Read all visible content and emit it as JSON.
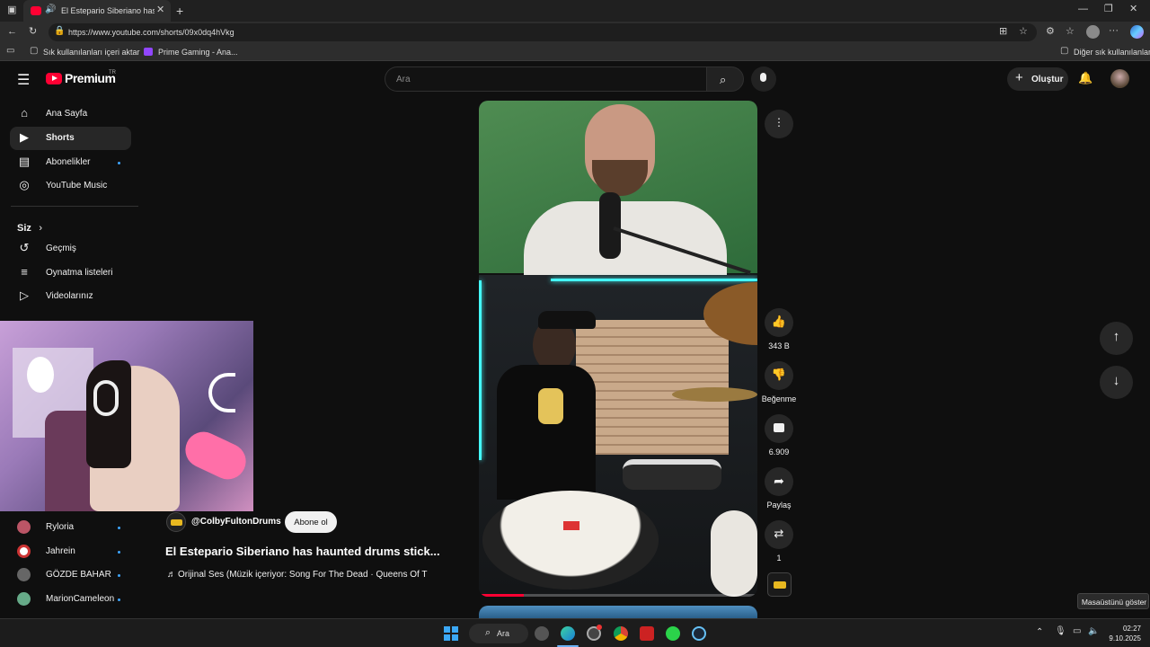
{
  "browser": {
    "tab_title": "El Estepario Siberiano has ha",
    "url": "https://www.youtube.com/shorts/09x0dq4hVkg",
    "favorites": {
      "import_label": "Sık kullanılanları içeri aktar",
      "prime_label": "Prime Gaming - Ana...",
      "other_label": "Diğer sık kullanılanlar"
    }
  },
  "header": {
    "brand": "Premium",
    "region": "TR",
    "search_placeholder": "Ara",
    "create_label": "Oluştur"
  },
  "sidebar": {
    "main": [
      {
        "label": "Ana Sayfa",
        "icon": "home-icon"
      },
      {
        "label": "Shorts",
        "icon": "shorts-icon"
      },
      {
        "label": "Abonelikler",
        "icon": "subscriptions-icon"
      },
      {
        "label": "YouTube Music",
        "icon": "music-icon"
      }
    ],
    "you_label": "Siz",
    "you": [
      {
        "label": "Geçmiş",
        "icon": "history-icon"
      },
      {
        "label": "Oynatma listeleri",
        "icon": "playlists-icon"
      },
      {
        "label": "Videolarınız",
        "icon": "your-videos-icon"
      }
    ],
    "subscriptions": [
      {
        "label": "Ryloria"
      },
      {
        "label": "Jahrein"
      },
      {
        "label": "GÖZDE BAHAR"
      },
      {
        "label": "MarionCameleon"
      }
    ]
  },
  "short": {
    "channel": "@ColbyFultonDrums",
    "subscribe_label": "Abone ol",
    "title": "El Estepario Siberiano has haunted drums stick...",
    "audio": "Orijinal Ses (Müzik içeriyor: Song For The Dead · Queens Of T",
    "progress": 0.16
  },
  "actions": {
    "likes": "343 B",
    "dislike_label": "Beğenme",
    "comments": "6.909",
    "share_label": "Paylaş",
    "remix_count": "1"
  },
  "taskbar": {
    "search_label": "Ara",
    "time": "02:27",
    "date": "9.10.2025",
    "tooltip": "Masaüstünü göster"
  },
  "colors": {
    "youtube_red": "#ff0033",
    "accent_blue": "#3ea6ff"
  }
}
